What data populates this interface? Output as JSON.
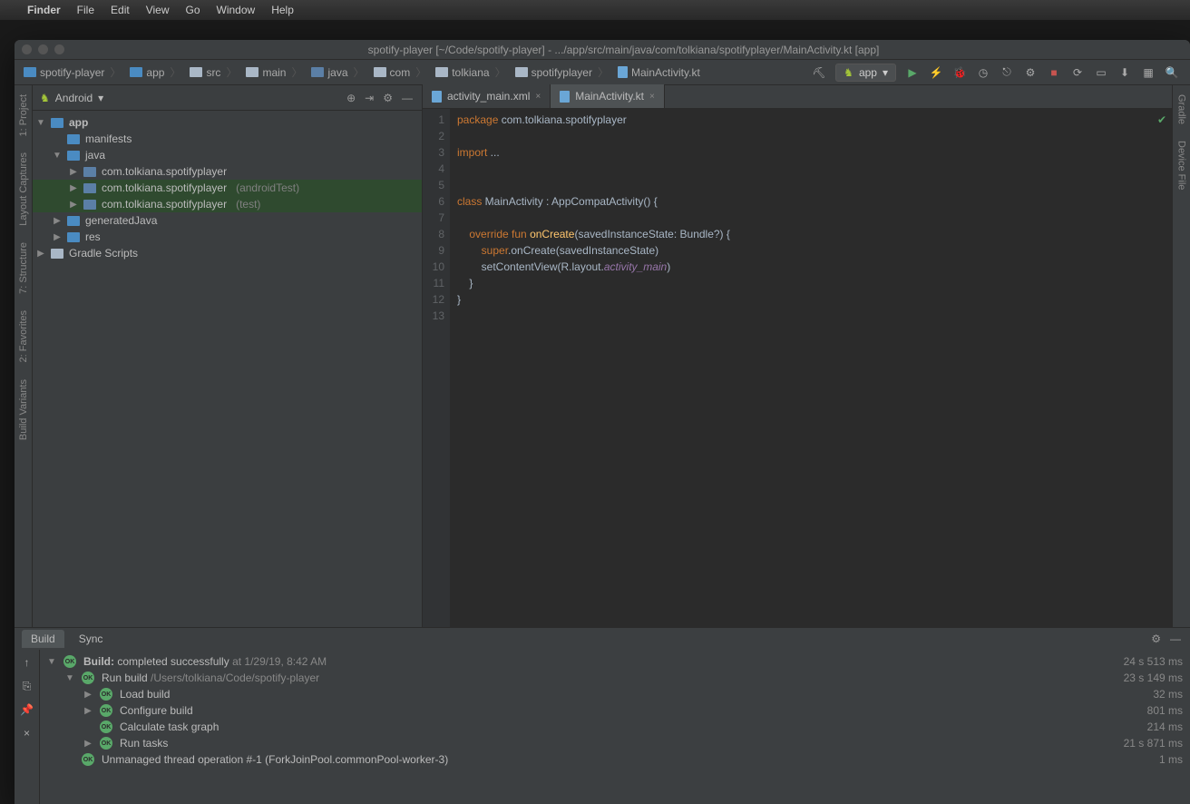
{
  "macos": {
    "app": "Finder",
    "menus": [
      "File",
      "Edit",
      "View",
      "Go",
      "Window",
      "Help"
    ]
  },
  "window": {
    "title": "spotify-player [~/Code/spotify-player] - .../app/src/main/java/com/tolkiana/spotifyplayer/MainActivity.kt [app]"
  },
  "breadcrumbs": [
    "spotify-player",
    "app",
    "src",
    "main",
    "java",
    "com",
    "tolkiana",
    "spotifyplayer",
    "MainActivity.kt"
  ],
  "run_config": "app",
  "project": {
    "view": "Android",
    "tree": [
      {
        "ind": 0,
        "tw": "▼",
        "icon": "folder",
        "label": "app",
        "bold": true
      },
      {
        "ind": 1,
        "tw": "",
        "icon": "folder",
        "label": "manifests"
      },
      {
        "ind": 1,
        "tw": "▼",
        "icon": "folder",
        "label": "java"
      },
      {
        "ind": 2,
        "tw": "▶",
        "icon": "pkg",
        "label": "com.tolkiana.spotifyplayer"
      },
      {
        "ind": 2,
        "tw": "▶",
        "icon": "pkg",
        "label": "com.tolkiana.spotifyplayer",
        "suffix": "(androidTest)",
        "sel": true
      },
      {
        "ind": 2,
        "tw": "▶",
        "icon": "pkg",
        "label": "com.tolkiana.spotifyplayer",
        "suffix": "(test)",
        "sel": true
      },
      {
        "ind": 1,
        "tw": "▶",
        "icon": "folder",
        "label": "generatedJava"
      },
      {
        "ind": 1,
        "tw": "▶",
        "icon": "folder",
        "label": "res"
      },
      {
        "ind": 0,
        "tw": "▶",
        "icon": "gradle",
        "label": "Gradle Scripts"
      }
    ]
  },
  "tabs": [
    {
      "label": "activity_main.xml",
      "active": false
    },
    {
      "label": "MainActivity.kt",
      "active": true
    }
  ],
  "code_lines": [
    "1",
    "2",
    "3",
    "4",
    "5",
    "6",
    "7",
    "8",
    "9",
    "10",
    "11",
    "12",
    "13"
  ],
  "code_tokens": {
    "l1": {
      "a": "package",
      "b": " com.tolkiana.spotifyplayer"
    },
    "l3": {
      "a": "import",
      "b": " ..."
    },
    "l6": {
      "a": "class",
      "b": " MainActivity : AppCompatActivity() {"
    },
    "l8": {
      "a": "override",
      "b": "fun",
      "c": "onCreate",
      "d": "(savedInstanceState: Bundle?) {"
    },
    "l9": {
      "a": "super",
      "b": ".onCreate(savedInstanceState)"
    },
    "l10": {
      "a": "        setContentView(R.layout.",
      "b": "activity_main",
      "c": ")"
    },
    "l11": "    }",
    "l12": "}"
  },
  "bottom": {
    "tabs": [
      "Build",
      "Sync"
    ],
    "rows": [
      {
        "ind": 0,
        "tw": "▼",
        "ok": true,
        "label_bold": "Build:",
        "label": " completed successfully",
        "meta": "at 1/29/19, 8:42 AM",
        "time": "24 s 513 ms"
      },
      {
        "ind": 1,
        "tw": "▼",
        "ok": true,
        "label": "Run build",
        "meta": "/Users/tolkiana/Code/spotify-player",
        "time": "23 s 149 ms"
      },
      {
        "ind": 2,
        "tw": "▶",
        "ok": true,
        "label": "Load build",
        "time": "32 ms"
      },
      {
        "ind": 2,
        "tw": "▶",
        "ok": true,
        "label": "Configure build",
        "time": "801 ms"
      },
      {
        "ind": 2,
        "tw": "",
        "ok": true,
        "label": "Calculate task graph",
        "time": "214 ms"
      },
      {
        "ind": 2,
        "tw": "▶",
        "ok": true,
        "label": "Run tasks",
        "time": "21 s 871 ms"
      },
      {
        "ind": 1,
        "tw": "",
        "ok": true,
        "label": "Unmanaged thread operation #-1 (ForkJoinPool.commonPool-worker-3)",
        "time": "1 ms"
      }
    ]
  },
  "left_rail": [
    "1: Project",
    "Layout Captures",
    "7: Structure",
    "2: Favorites",
    "Build Variants"
  ],
  "right_rail": [
    "Gradle",
    "Device File"
  ]
}
